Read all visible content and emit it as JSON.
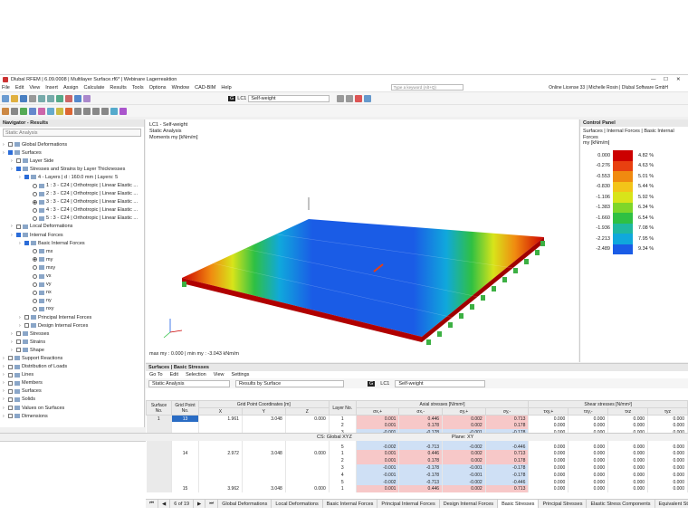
{
  "title": "Dlubal RFEM | 6.09.0008 | Multilayer Surface.rf6* | Webinare Lagerreaktion",
  "menu": [
    "File",
    "Edit",
    "View",
    "Insert",
    "Assign",
    "Calculate",
    "Results",
    "Tools",
    "Options",
    "Window",
    "CAD-BIM",
    "Help"
  ],
  "search_placeholder": "Type a keyword (Alt+Q)",
  "license": "Online License 33 | Michelle Rosin | Dlubal Software GmbH",
  "toolbar": {
    "lc_badge": "G",
    "lc": "LC1",
    "lc_name": "Self-weight"
  },
  "navigator": {
    "title": "Navigator - Results",
    "combo": "Static Analysis",
    "items": [
      {
        "label": "Global Deformations",
        "indent": 0,
        "kind": "cb"
      },
      {
        "label": "Surfaces",
        "indent": 0,
        "kind": "cbon"
      },
      {
        "label": "Layer Side",
        "indent": 1,
        "kind": "cb"
      },
      {
        "label": "Stresses and Strains by Layer Thicknesses",
        "indent": 1,
        "kind": "cbon"
      },
      {
        "label": "4 - Layers | d : 160.0 mm | Layers: 5",
        "indent": 2,
        "kind": "cbon"
      },
      {
        "label": "1 : 3 - C24 | Orthotropic | Linear Elastic ...",
        "indent": 3,
        "kind": "rad"
      },
      {
        "label": "2 : 3 - C24 | Orthotropic | Linear Elastic ...",
        "indent": 3,
        "kind": "rad"
      },
      {
        "label": "3 : 3 - C24 | Orthotropic | Linear Elastic ...",
        "indent": 3,
        "kind": "radon"
      },
      {
        "label": "4 : 3 - C24 | Orthotropic | Linear Elastic ...",
        "indent": 3,
        "kind": "rad"
      },
      {
        "label": "5 : 3 - C24 | Orthotropic | Linear Elastic ...",
        "indent": 3,
        "kind": "rad"
      },
      {
        "label": "Local Deformations",
        "indent": 1,
        "kind": "cb"
      },
      {
        "label": "Internal Forces",
        "indent": 1,
        "kind": "cbon"
      },
      {
        "label": "Basic Internal Forces",
        "indent": 2,
        "kind": "cbon"
      },
      {
        "label": "mx",
        "indent": 3,
        "kind": "rad"
      },
      {
        "label": "my",
        "indent": 3,
        "kind": "radon"
      },
      {
        "label": "mxy",
        "indent": 3,
        "kind": "rad"
      },
      {
        "label": "vx",
        "indent": 3,
        "kind": "rad"
      },
      {
        "label": "vy",
        "indent": 3,
        "kind": "rad"
      },
      {
        "label": "nx",
        "indent": 3,
        "kind": "rad"
      },
      {
        "label": "ny",
        "indent": 3,
        "kind": "rad"
      },
      {
        "label": "nxy",
        "indent": 3,
        "kind": "rad"
      },
      {
        "label": "Principal Internal Forces",
        "indent": 2,
        "kind": "cb"
      },
      {
        "label": "Design Internal Forces",
        "indent": 2,
        "kind": "cb"
      },
      {
        "label": "Stresses",
        "indent": 1,
        "kind": "cb"
      },
      {
        "label": "Strains",
        "indent": 1,
        "kind": "cb"
      },
      {
        "label": "Shape",
        "indent": 1,
        "kind": "cb"
      },
      {
        "label": "Support Reactions",
        "indent": 0,
        "kind": "cb"
      },
      {
        "label": "Distribution of Loads",
        "indent": 0,
        "kind": "cb"
      },
      {
        "label": "Lines",
        "indent": 0,
        "kind": "cb"
      },
      {
        "label": "Members",
        "indent": 0,
        "kind": "cb"
      },
      {
        "label": "Surfaces",
        "indent": 0,
        "kind": "cb"
      },
      {
        "label": "Solids",
        "indent": 0,
        "kind": "cb"
      },
      {
        "label": "Values on Surfaces",
        "indent": 0,
        "kind": "cb"
      },
      {
        "label": "Dimensions",
        "indent": 0,
        "kind": "cb"
      }
    ]
  },
  "view": {
    "lc": "LC1 - Self-weight",
    "analysis": "Static Analysis",
    "quantity": "Moments my [kNm/m]",
    "maxmin": "max my : 0.000 | min my : -3.043 kNm/m"
  },
  "control": {
    "title": "Control Panel",
    "sub1": "Surfaces | Internal Forces | Basic Internal Forces",
    "sub2": "my [kNm/m]",
    "legend": [
      {
        "value": "0.000",
        "color": "#cc0000",
        "pct": "4.82 %"
      },
      {
        "value": "-0.276",
        "color": "#e84010",
        "pct": "4.63 %"
      },
      {
        "value": "-0.553",
        "color": "#f08a10",
        "pct": "5.01 %"
      },
      {
        "value": "-0.830",
        "color": "#f3c419",
        "pct": "5.44 %"
      },
      {
        "value": "-1.106",
        "color": "#d8e41a",
        "pct": "5.92 %"
      },
      {
        "value": "-1.383",
        "color": "#7ed62a",
        "pct": "6.34 %"
      },
      {
        "value": "-1.660",
        "color": "#2fc043",
        "pct": "6.54 %"
      },
      {
        "value": "-1.936",
        "color": "#1fb8a0",
        "pct": "7.08 %"
      },
      {
        "value": "-2.213",
        "color": "#10a8dc",
        "pct": "7.95 %"
      },
      {
        "value": "-2.489",
        "color": "#1a5ce6",
        "pct": "9.34 %"
      }
    ]
  },
  "results": {
    "title": "Surfaces | Basic Stresses",
    "menu": [
      "Go To",
      "Edit",
      "Selection",
      "View",
      "Settings"
    ],
    "combo1": "Static Analysis",
    "combo2": "Results by Surface",
    "lc": "LC1",
    "lc_name": "Self-weight",
    "headers": {
      "surface": "Surface No.",
      "grid": "Grid Point No.",
      "coords": "Grid Point Coordinates [m]",
      "x": "X",
      "y": "Y",
      "z": "Z",
      "layer": "Layer No.",
      "axial": "Axial stresses [N/mm²]",
      "shear": "Shear stresses [N/mm²]",
      "cols": [
        "σx,+",
        "σx,-",
        "σy,+",
        "σy,-",
        "τxy,+",
        "τxy,-",
        "τxz",
        "τyz"
      ]
    },
    "rows": [
      {
        "s": "1",
        "g": "13",
        "x": "1.961",
        "y": "3.048",
        "z": "0.000",
        "l": "1",
        "v": [
          "0.001",
          "0.446",
          "0.002",
          "0.713",
          "0.000",
          "0.000",
          "0.000",
          "0.000"
        ]
      },
      {
        "s": "",
        "g": "",
        "x": "",
        "y": "",
        "z": "",
        "l": "2",
        "v": [
          "0.001",
          "0.178",
          "0.002",
          "0.178",
          "0.000",
          "0.000",
          "0.000",
          "0.000"
        ]
      },
      {
        "s": "",
        "g": "",
        "x": "",
        "y": "",
        "z": "",
        "l": "3",
        "v": [
          "-0.001",
          "-0.178",
          "-0.001",
          "-0.178",
          "0.000",
          "0.000",
          "0.000",
          "0.000"
        ]
      },
      {
        "s": "",
        "g": "",
        "x": "",
        "y": "",
        "z": "",
        "l": "4",
        "v": [
          "-0.001",
          "-0.178",
          "-0.001",
          "-0.178",
          "0.000",
          "0.000",
          "0.000",
          "0.000"
        ]
      },
      {
        "s": "",
        "g": "",
        "x": "",
        "y": "",
        "z": "",
        "l": "5",
        "v": [
          "-0.002",
          "-0.713",
          "-0.002",
          "-0.446",
          "0.000",
          "0.000",
          "0.000",
          "0.000"
        ]
      },
      {
        "s": "",
        "g": "14",
        "x": "2.972",
        "y": "3.048",
        "z": "0.000",
        "l": "1",
        "v": [
          "0.001",
          "0.446",
          "0.002",
          "0.713",
          "0.000",
          "0.000",
          "0.000",
          "0.000"
        ]
      },
      {
        "s": "",
        "g": "",
        "x": "",
        "y": "",
        "z": "",
        "l": "2",
        "v": [
          "0.001",
          "0.178",
          "0.002",
          "0.178",
          "0.000",
          "0.000",
          "0.000",
          "0.000"
        ]
      },
      {
        "s": "",
        "g": "",
        "x": "",
        "y": "",
        "z": "",
        "l": "3",
        "v": [
          "-0.001",
          "-0.178",
          "-0.001",
          "-0.178",
          "0.000",
          "0.000",
          "0.000",
          "0.000"
        ]
      },
      {
        "s": "",
        "g": "",
        "x": "",
        "y": "",
        "z": "",
        "l": "4",
        "v": [
          "-0.001",
          "-0.178",
          "-0.001",
          "-0.178",
          "0.000",
          "0.000",
          "0.000",
          "0.000"
        ]
      },
      {
        "s": "",
        "g": "",
        "x": "",
        "y": "",
        "z": "",
        "l": "5",
        "v": [
          "-0.002",
          "-0.713",
          "-0.002",
          "-0.446",
          "0.000",
          "0.000",
          "0.000",
          "0.000"
        ]
      },
      {
        "s": "",
        "g": "15",
        "x": "3.962",
        "y": "3.048",
        "z": "0.000",
        "l": "1",
        "v": [
          "0.001",
          "0.446",
          "0.002",
          "0.713",
          "0.000",
          "0.000",
          "0.000",
          "0.000"
        ]
      }
    ],
    "pager": "6 of 19",
    "tabs": [
      "Global Deformations",
      "Local Deformations",
      "Basic Internal Forces",
      "Principal Internal Forces",
      "Design Internal Forces",
      "Basic Stresses",
      "Principal Stresses",
      "Elastic Stress Components",
      "Equivalent Stresses - von Mises",
      "Equiv"
    ],
    "active_tab": "Basic Stresses"
  },
  "status": {
    "cs": "CS: Global XYZ",
    "plane": "Plane: XY"
  }
}
